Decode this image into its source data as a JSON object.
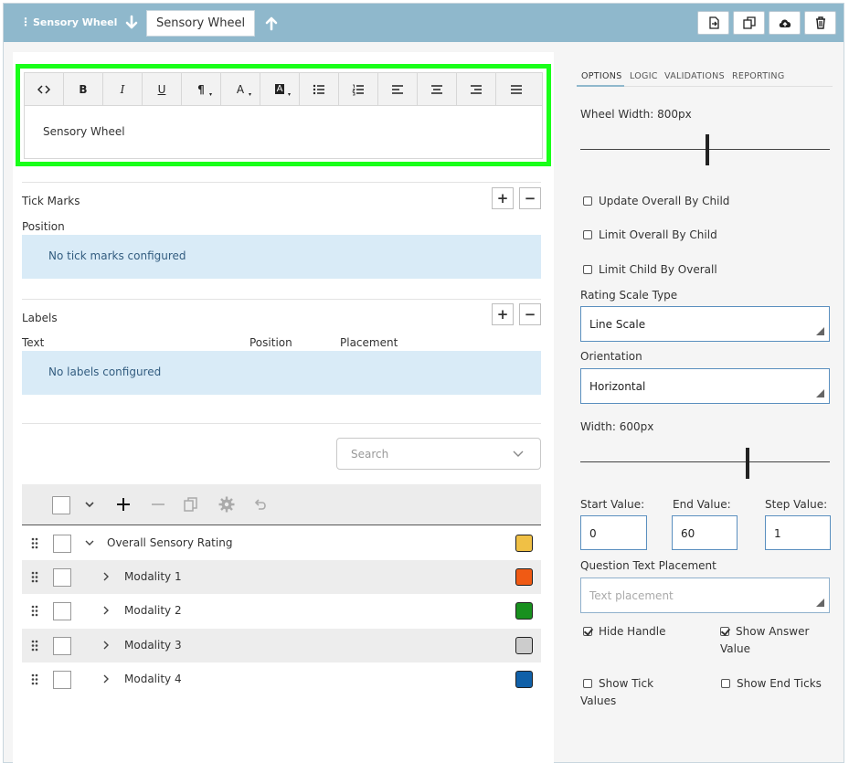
{
  "header": {
    "handle_glyph": "⋮",
    "title": "Sensory Wheel",
    "title_input_value": "Sensory Wheel",
    "actions": [
      "copy-icon",
      "duplicate-icon",
      "cloud-upload-icon",
      "trash-icon"
    ],
    "bg_color": "#8fb8cc"
  },
  "editor": {
    "toolbar": [
      {
        "name": "code-view-button",
        "glyph": "<>"
      },
      {
        "name": "bold-button",
        "glyph": "B"
      },
      {
        "name": "italic-button",
        "glyph": "I"
      },
      {
        "name": "underline-button",
        "glyph": "U"
      },
      {
        "name": "paragraph-button",
        "glyph": "¶"
      },
      {
        "name": "font-color-button",
        "glyph": "A"
      },
      {
        "name": "highlight-button",
        "glyph": "A"
      },
      {
        "name": "bullet-list-button",
        "glyph": ""
      },
      {
        "name": "numbered-list-button",
        "glyph": ""
      },
      {
        "name": "align-left-button",
        "glyph": ""
      },
      {
        "name": "align-center-button",
        "glyph": ""
      },
      {
        "name": "align-right-button",
        "glyph": ""
      },
      {
        "name": "justify-button",
        "glyph": ""
      }
    ],
    "content": "Sensory Wheel",
    "highlight_color": "#19ff19"
  },
  "tick_marks": {
    "title": "Tick Marks",
    "column": "Position",
    "empty_text": "No tick marks configured",
    "add": "+",
    "remove": "−"
  },
  "labels": {
    "title": "Labels",
    "columns": [
      "Text",
      "Position",
      "Placement"
    ],
    "empty_text": "No labels configured",
    "add": "+",
    "remove": "−"
  },
  "search": {
    "placeholder": "Search"
  },
  "tree": {
    "rows": [
      {
        "label": "Overall Sensory Rating",
        "color": "#f0c045",
        "expanded": true,
        "level": 0
      },
      {
        "label": "Modality 1",
        "color": "#f05a14",
        "expanded": false,
        "level": 1
      },
      {
        "label": "Modality 2",
        "color": "#18901e",
        "expanded": false,
        "level": 1
      },
      {
        "label": "Modality 3",
        "color": "#cccccc",
        "expanded": false,
        "level": 1
      },
      {
        "label": "Modality 4",
        "color": "#1060a8",
        "expanded": false,
        "level": 1
      }
    ]
  },
  "options": {
    "tabs": [
      "OPTIONS",
      "LOGIC",
      "VALIDATIONS",
      "REPORTING"
    ],
    "wheel_width_label": "Wheel Width: 800px",
    "wheel_width_fraction": 0.51,
    "checkboxes_top": [
      {
        "label": "Update Overall By Child",
        "checked": false
      },
      {
        "label": "Limit Overall By Child",
        "checked": false
      },
      {
        "label": "Limit Child By Overall",
        "checked": false
      }
    ],
    "rating_scale_type_label": "Rating Scale Type",
    "rating_scale_type_value": "Line Scale",
    "orientation_label": "Orientation",
    "orientation_value": "Horizontal",
    "width_label": "Width: 600px",
    "width_fraction": 0.67,
    "start_label": "Start Value:",
    "start_value": "0",
    "end_label": "End Value:",
    "end_value": "60",
    "step_label": "Step Value:",
    "step_value": "1",
    "question_text_placement_label": "Question Text Placement",
    "question_text_placement_placeholder": "Text placement",
    "hide_handle": {
      "label": "Hide Handle",
      "checked": true
    },
    "show_answer_value": {
      "label_line1": "Show Answer",
      "label_line2": "Value",
      "checked": true
    },
    "show_tick_values": {
      "label_line1": "Show Tick",
      "label_line2": "Values",
      "checked": false
    },
    "show_end_ticks": {
      "label": "Show End Ticks",
      "checked": false
    }
  }
}
